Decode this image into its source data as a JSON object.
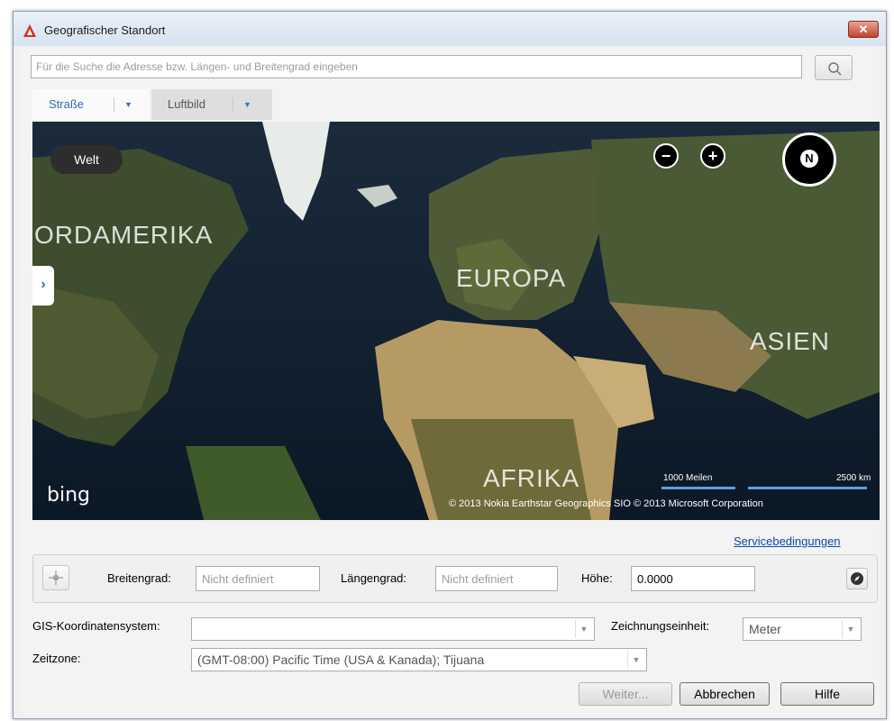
{
  "window": {
    "title": "Geografischer Standort",
    "close_label": "✕"
  },
  "search": {
    "placeholder": "Für die Suche die Adresse bzw. Längen- und Breitengrad eingeben"
  },
  "tabs": [
    {
      "label": "Straße",
      "active": true
    },
    {
      "label": "Luftbild",
      "active": false
    }
  ],
  "map": {
    "world_button": "Welt",
    "zoom_out": "−",
    "zoom_in": "+",
    "compass": "N",
    "side_toggle": "›",
    "labels": {
      "north_america": "ORDAMERIKA",
      "europe": "EUROPA",
      "asia": "ASIEN",
      "africa": "AFRIKA"
    },
    "brand": "bing",
    "scale_miles": "1000 Meilen",
    "scale_km": "2500 km",
    "copyright": "© 2013 Nokia    Earthstar Geographics SIO    © 2013 Microsoft Corporation"
  },
  "links": {
    "service_terms": "Servicebedingungen"
  },
  "coords": {
    "lat_label": "Breitengrad:",
    "lat_value": "Nicht definiert",
    "lon_label": "Längengrad:",
    "lon_value": "Nicht definiert",
    "height_label": "Höhe:",
    "height_value": "0.0000"
  },
  "gis": {
    "label": "GIS-Koordinatensystem:",
    "value": ""
  },
  "units": {
    "label": "Zeichnungseinheit:",
    "value": "Meter"
  },
  "timezone": {
    "label": "Zeitzone:",
    "value": "(GMT-08:00) Pacific Time (USA & Kanada); Tijuana"
  },
  "buttons": {
    "next": "Weiter...",
    "cancel": "Abbrechen",
    "help": "Hilfe"
  },
  "colors": {
    "accent": "#2e6db4",
    "link": "#0a4aa8",
    "close": "#c4412b"
  }
}
